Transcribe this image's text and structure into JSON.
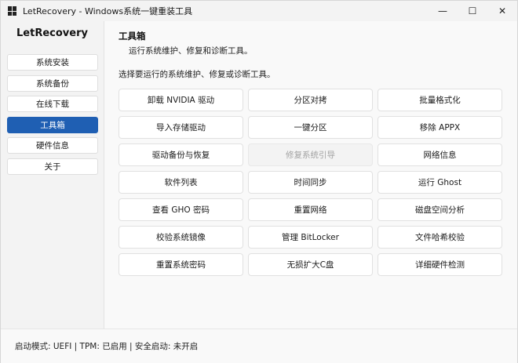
{
  "window": {
    "title": "LetRecovery - Windows系统一键重装工具",
    "controls": {
      "minimize": "—",
      "maximize": "☐",
      "close": "✕"
    }
  },
  "sidebar": {
    "brand": "LetRecovery",
    "items": [
      {
        "label": "系统安装"
      },
      {
        "label": "系统备份"
      },
      {
        "label": "在线下载"
      },
      {
        "label": "工具箱",
        "active": true
      },
      {
        "label": "硬件信息"
      },
      {
        "label": "关于"
      }
    ]
  },
  "main": {
    "title": "工具箱",
    "description": "运行系统维护、修复和诊断工具。",
    "prompt": "选择要运行的系统维护、修复或诊断工具。",
    "tools": [
      {
        "label": "卸载 NVIDIA 驱动"
      },
      {
        "label": "分区对拷"
      },
      {
        "label": "批量格式化"
      },
      {
        "label": "导入存储驱动"
      },
      {
        "label": "一键分区"
      },
      {
        "label": "移除 APPX"
      },
      {
        "label": "驱动备份与恢复"
      },
      {
        "label": "修复系统引导",
        "disabled": true
      },
      {
        "label": "网络信息"
      },
      {
        "label": "软件列表"
      },
      {
        "label": "时间同步"
      },
      {
        "label": "运行 Ghost"
      },
      {
        "label": "查看 GHO 密码"
      },
      {
        "label": "重置网络"
      },
      {
        "label": "磁盘空间分析"
      },
      {
        "label": "校验系统镜像"
      },
      {
        "label": "管理 BitLocker"
      },
      {
        "label": "文件哈希校验"
      },
      {
        "label": "重置系统密码"
      },
      {
        "label": "无损扩大C盘"
      },
      {
        "label": "详细硬件检测"
      }
    ]
  },
  "status": {
    "text": "启动模式: UEFI | TPM: 已启用 | 安全启动: 未开启"
  },
  "colors": {
    "accent": "#1f5fb3",
    "window_bg": "#f9f9f9",
    "sidebar_bg": "#f3f3f3"
  }
}
